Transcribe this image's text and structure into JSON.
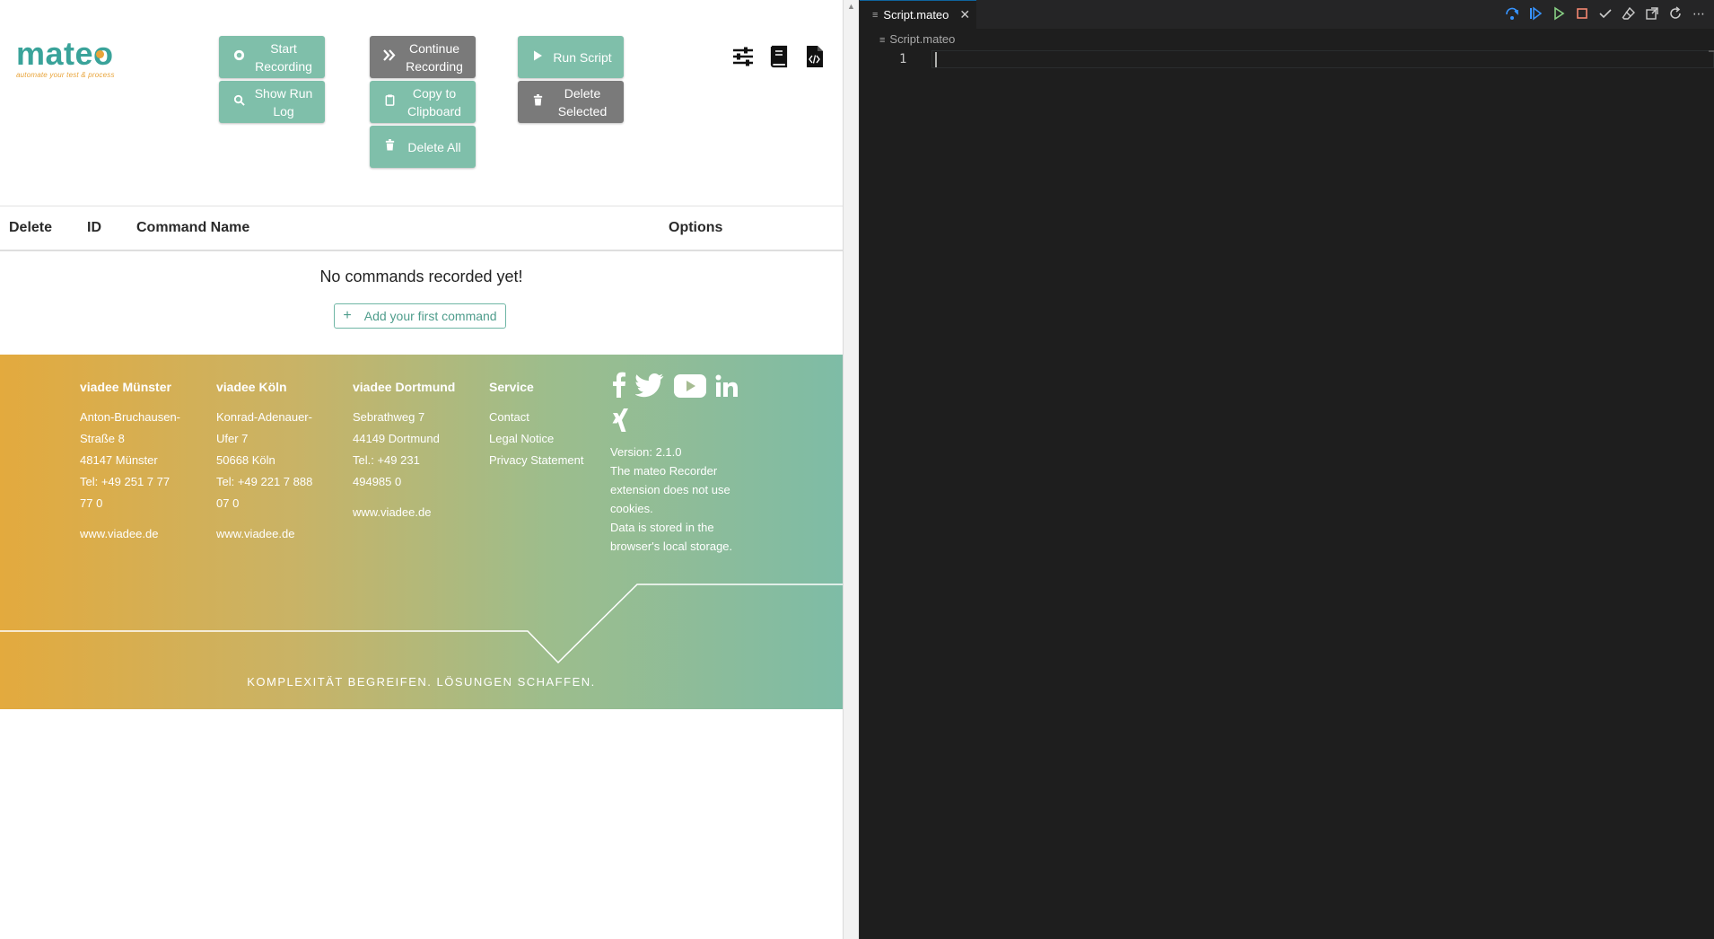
{
  "app": {
    "logo_text": "mateo",
    "logo_tagline": "automate your test & process"
  },
  "toolbar": {
    "start_recording": "Start Recording",
    "show_run_log": "Show Run Log",
    "continue_recording": "Continue Recording",
    "copy_to_clipboard": "Copy to Clipboard",
    "delete_all": "Delete All",
    "run_script": "Run Script",
    "delete_selected": "Delete Selected",
    "colors": {
      "green": "#7fbfaa",
      "gray": "#7a7a7a"
    }
  },
  "table": {
    "columns": [
      "Delete",
      "ID",
      "Command Name",
      "Options"
    ],
    "empty_message": "No commands recorded yet!",
    "add_first_label": "Add your first command"
  },
  "footer": {
    "offices": [
      {
        "title": "viadee Münster",
        "lines": [
          "Anton-Bruchausen-",
          "Straße 8",
          "48147 Münster",
          "Tel: +49 251 7 77",
          "77 0"
        ],
        "web": "www.viadee.de"
      },
      {
        "title": "viadee Köln",
        "lines": [
          "Konrad-Adenauer-",
          "Ufer 7",
          "50668 Köln",
          "Tel: +49 221 7 888",
          "07 0"
        ],
        "web": "www.viadee.de"
      },
      {
        "title": "viadee Dortmund",
        "lines": [
          "Sebrathweg 7",
          "44149 Dortmund",
          "Tel.: +49 231",
          "494985 0"
        ],
        "web": "www.viadee.de"
      }
    ],
    "service": {
      "title": "Service",
      "links": [
        "Contact",
        "Legal Notice",
        "Privacy Statement"
      ]
    },
    "social_icons": [
      "facebook-icon",
      "twitter-icon",
      "youtube-icon",
      "linkedin-icon",
      "xing-icon"
    ],
    "version": "Version: 2.1.0",
    "cookie_note": "The mateo Recorder extension does not use cookies.",
    "storage_note": "Data is stored in the browser's local storage.",
    "slogan": "KOMPLEXITÄT BEGREIFEN. LÖSUNGEN SCHAFFEN."
  },
  "editor": {
    "tab_title": "Script.mateo",
    "breadcrumb": "Script.mateo",
    "line_numbers": [
      "1"
    ]
  }
}
